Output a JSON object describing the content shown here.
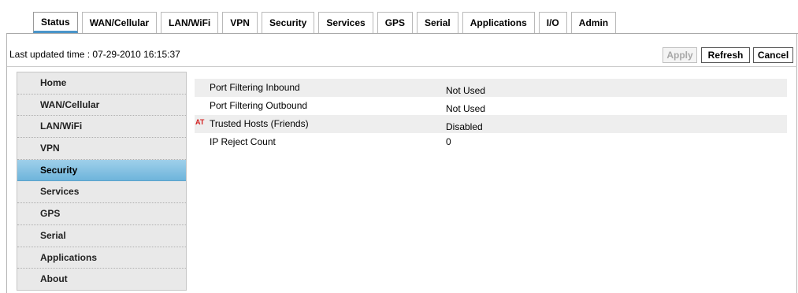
{
  "top_tabs": [
    "Status",
    "WAN/Cellular",
    "LAN/WiFi",
    "VPN",
    "Security",
    "Services",
    "GPS",
    "Serial",
    "Applications",
    "I/O",
    "Admin"
  ],
  "active_tab": "Status",
  "last_updated": "Last updated time : 07-29-2010 16:15:37",
  "buttons": {
    "apply": "Apply",
    "refresh": "Refresh",
    "cancel": "Cancel"
  },
  "side_nav": [
    "Home",
    "WAN/Cellular",
    "LAN/WiFi",
    "VPN",
    "Security",
    "Services",
    "GPS",
    "Serial",
    "Applications",
    "About"
  ],
  "active_nav": "Security",
  "rows": [
    {
      "marker": "",
      "label": "Port Filtering Inbound",
      "value": "Not Used"
    },
    {
      "marker": "",
      "label": "Port Filtering Outbound",
      "value": "Not Used"
    },
    {
      "marker": "AT",
      "label": "Trusted Hosts (Friends)",
      "value": "Disabled"
    },
    {
      "marker": "",
      "label": "IP Reject Count",
      "value": "0"
    }
  ],
  "colors": {
    "accent": "#6eb4db",
    "marker": "#d42020"
  }
}
